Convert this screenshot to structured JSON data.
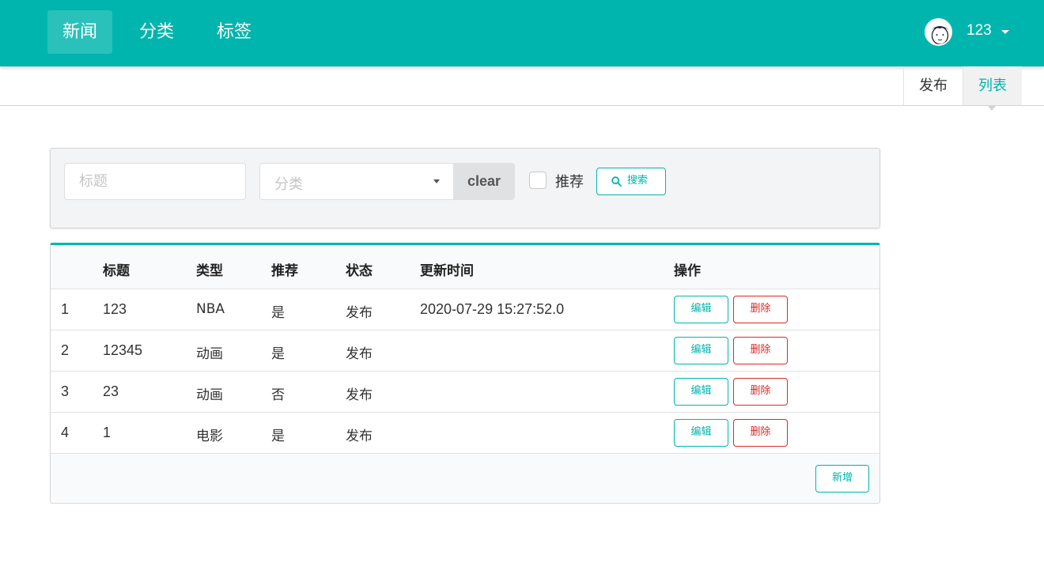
{
  "nav": {
    "items": [
      "新闻",
      "分类",
      "标签"
    ],
    "user_name": "123"
  },
  "submenu": {
    "publish": "发布",
    "list": "列表"
  },
  "search": {
    "title_placeholder": "标题",
    "category_placeholder": "分类",
    "clear_label": "clear",
    "recommend_label": "推荐",
    "search_label": "搜索"
  },
  "table": {
    "headers": [
      "",
      "标题",
      "类型",
      "推荐",
      "状态",
      "更新时间",
      "操作"
    ],
    "rows": [
      {
        "index": "1",
        "title": "123",
        "type": "NBA",
        "recommend": "是",
        "status": "发布",
        "updated": "2020-07-29 15:27:52.0"
      },
      {
        "index": "2",
        "title": "12345",
        "type": "动画",
        "recommend": "是",
        "status": "发布",
        "updated": ""
      },
      {
        "index": "3",
        "title": "23",
        "type": "动画",
        "recommend": "否",
        "status": "发布",
        "updated": ""
      },
      {
        "index": "4",
        "title": "1",
        "type": "电影",
        "recommend": "是",
        "status": "发布",
        "updated": ""
      }
    ],
    "edit_label": "编辑",
    "delete_label": "删除",
    "add_label": "新增"
  },
  "colors": {
    "accent": "#00b5ad",
    "danger": "#db2828"
  }
}
